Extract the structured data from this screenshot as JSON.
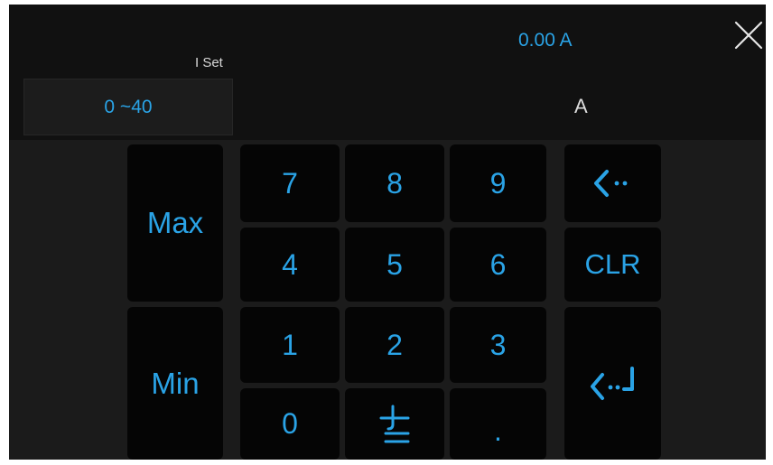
{
  "header": {
    "param_label": "I Set",
    "range": "0 ~40",
    "current_value": "0.00 A",
    "unit": "A"
  },
  "icons": {
    "close": "close-x-icon",
    "backspace": "backspace-arrow-icon",
    "sign": "plus-minus-icon",
    "enter": "enter-arrow-icon"
  },
  "keypad": {
    "max_label": "Max",
    "min_label": "Min",
    "clr_label": "CLR",
    "digits": {
      "k7": "7",
      "k8": "8",
      "k9": "9",
      "k4": "4",
      "k5": "5",
      "k6": "6",
      "k1": "1",
      "k2": "2",
      "k3": "3",
      "k0": "0",
      "dot": "."
    }
  },
  "colors": {
    "accent": "#2aa3e6",
    "key_bg": "#050505",
    "panel_bg": "#1b1b1b",
    "header_bg": "#111111"
  }
}
